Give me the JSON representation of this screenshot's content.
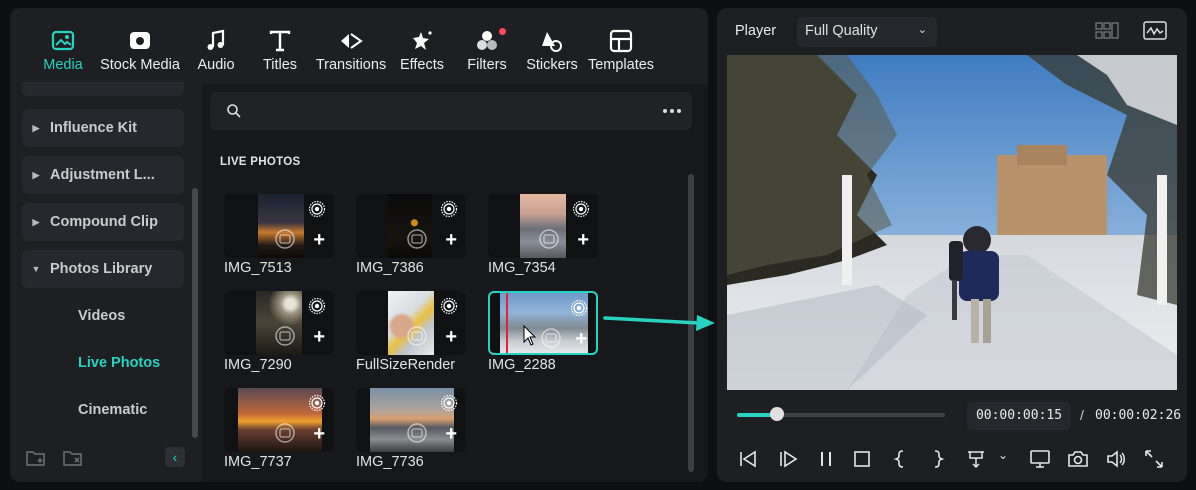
{
  "toolbar": {
    "tabs": [
      {
        "label": "Media",
        "icon": "media-icon"
      },
      {
        "label": "Stock Media",
        "icon": "stock-media-icon"
      },
      {
        "label": "Audio",
        "icon": "music-note-icon"
      },
      {
        "label": "Titles",
        "icon": "text-icon"
      },
      {
        "label": "Transitions",
        "icon": "transitions-icon"
      },
      {
        "label": "Effects",
        "icon": "effects-icon"
      },
      {
        "label": "Filters",
        "icon": "filters-icon"
      },
      {
        "label": "Stickers",
        "icon": "stickers-icon"
      },
      {
        "label": "Templates",
        "icon": "templates-icon"
      }
    ],
    "active_tab": "Media",
    "accent": "#27d3c0"
  },
  "sidebar": {
    "items": [
      {
        "label": "Influence Kit",
        "expanded": false
      },
      {
        "label": "Adjustment L...",
        "expanded": false
      },
      {
        "label": "Compound Clip",
        "expanded": false
      },
      {
        "label": "Photos Library",
        "expanded": true
      }
    ],
    "sub_items": [
      {
        "label": "Videos"
      },
      {
        "label": "Live Photos"
      },
      {
        "label": "Cinematic"
      }
    ],
    "active_sub": "Live Photos"
  },
  "content": {
    "section_title": "LIVE PHOTOS",
    "thumbnails": [
      {
        "label": "IMG_7513"
      },
      {
        "label": "IMG_7386"
      },
      {
        "label": "IMG_7354"
      },
      {
        "label": "IMG_7290"
      },
      {
        "label": "FullSizeRender"
      },
      {
        "label": "IMG_2288",
        "selected": true
      },
      {
        "label": "IMG_7737"
      },
      {
        "label": "IMG_7736"
      }
    ]
  },
  "player": {
    "label": "Player",
    "quality": "Full Quality",
    "current_time": "00:00:00:15",
    "separator": "/",
    "duration": "00:00:02:26",
    "progress": 0.19
  }
}
